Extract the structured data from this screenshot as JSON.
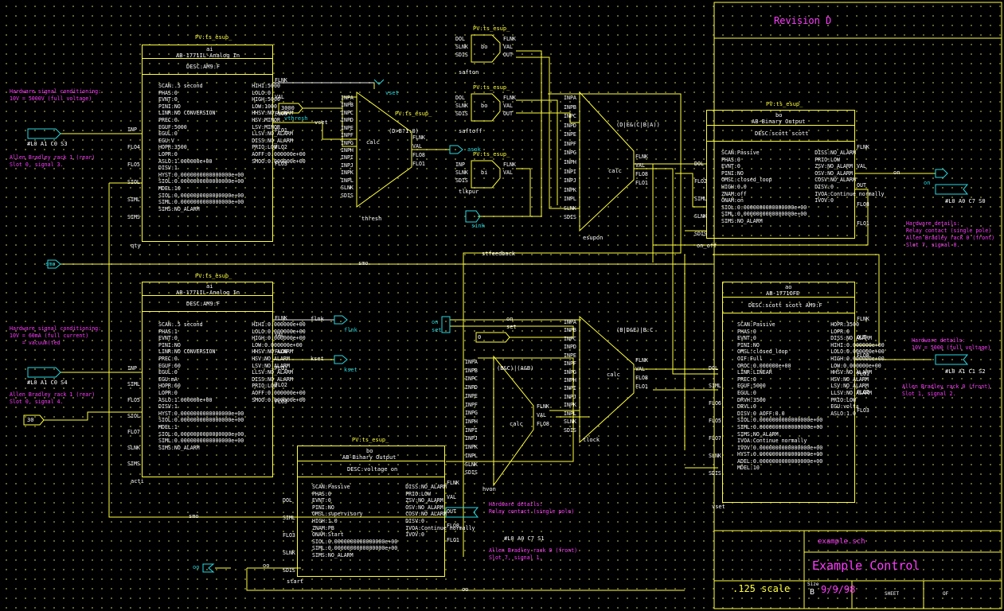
{
  "title_block": {
    "revision": "Revision D",
    "file": "example.sch",
    "drawing_title": "Example Control",
    "scale": ".125 scale",
    "size_label": "Size",
    "size": "B",
    "date": "9/9/98",
    "sheet_label": "SHEET",
    "of_label": "OF"
  },
  "ai_top": {
    "pv": "PV:ts_esup_",
    "type": "ai",
    "model": "AB-1771IL-Analog In",
    "desc": "DESC:AM9:F",
    "name": "qty",
    "fields": [
      [
        "SCAN:.5 second",
        "HIHI:5000"
      ],
      [
        "PHAS:0",
        "LOLO:0"
      ],
      [
        "EVNT:0",
        "HIGH:5000"
      ],
      [
        "PINI:NO",
        "LOW:1000"
      ],
      [
        "LINR:NO CONVERSION",
        "HHSV:NO_ALARM"
      ],
      [
        "PREC:0",
        "HSV:MINOR"
      ],
      [
        "EGUF:5000",
        "LSV:MINOR"
      ],
      [
        "EGUL:0",
        "LLSV:NO_ALARM"
      ],
      [
        "EGU:V",
        "DISS:NO_ALARM"
      ],
      [
        "HOPR:3500",
        "PRIO:LOW"
      ],
      [
        "LOPR:0",
        "AOFF:0.000000e+00"
      ],
      [
        "ASLO:1.000000e+00",
        "SMOO:0.000000e+00"
      ],
      [
        "DISV:1",
        ""
      ],
      [
        "HYST:0.0000000000000000e+00",
        ""
      ],
      [
        "SIOL:0.0000000000000000e+00",
        ""
      ],
      [
        "MDEL:10",
        ""
      ],
      [
        "SIOL:0.0000000000000000e+00",
        ""
      ],
      [
        "SIML:0.0000000000000000e+00",
        ""
      ],
      [
        "SIMS:NO_ALARM",
        ""
      ]
    ],
    "in_pins": [
      "INP",
      "FLO4",
      "FLO5",
      "SIOL",
      "SIML",
      "SIMS"
    ],
    "out_pins": [
      "FLNK",
      "VAL",
      "FLO8",
      "FLO1",
      "FLO2",
      "FLO3"
    ]
  },
  "ai_bottom": {
    "pv": "PV:ts_esup_",
    "type": "ai",
    "model": "AB-1771IL-Analog In",
    "desc": "DESC:AM9:F",
    "name": "acti",
    "fields": [
      [
        "SCAN:.5 second",
        "HIHI:0.000000e+00"
      ],
      [
        "PHAS:1",
        "LOLO:0.000000e+00"
      ],
      [
        "EVNT:0",
        "HIGH:0.000000e+00"
      ],
      [
        "PINI:NO",
        "LOW:0.000000e+00"
      ],
      [
        "LINR:NO CONVERSION",
        "HHSV:NO_ALARM"
      ],
      [
        "PREC:0",
        "HSV:NO_ALARM"
      ],
      [
        "EGUF:60",
        "LSV:NO_ALARM"
      ],
      [
        "EGUL:0",
        "LLSV:NO_ALARM"
      ],
      [
        "EGU:mA",
        "DISS:NO_ALARM"
      ],
      [
        "HOPR:60",
        "PRIO:LOW"
      ],
      [
        "LOPR:0",
        "AOFF:0.000000e+00"
      ],
      [
        "ASLO:1.000000e+00",
        "SMOO:0.000000e+00"
      ],
      [
        "DISV:1",
        ""
      ],
      [
        "HYST:0.0000000000000000e+00",
        ""
      ],
      [
        "SIOL:0.0000000000000000e+00",
        ""
      ],
      [
        "MDEL:1",
        ""
      ],
      [
        "SIOL:0.0000000000000000e+00",
        ""
      ],
      [
        "SIML:0.0000000000000000e+00",
        ""
      ],
      [
        "SIMS:NO_ALARM",
        ""
      ]
    ],
    "in_pins": [
      "INP",
      "SIML",
      "FLO5",
      "SIOL",
      "FLO7",
      "SLNK",
      "SIMS"
    ],
    "out_pins": [
      "FLNK",
      "VAL",
      "FLO8",
      "FLO1",
      "FLO2",
      "FLO3"
    ]
  },
  "bo_bottom": {
    "pv": "PV:ts_esup_",
    "type": "bo",
    "model": "AB-Binary Output",
    "desc": "DESC:voltage on",
    "name": "start",
    "fields": [
      [
        "SCAN:Passive",
        "DISS:NO_ALARM"
      ],
      [
        "PHAS:0",
        "PRIO:LOW"
      ],
      [
        "EVNT:0",
        "ZSV:NO_ALARM"
      ],
      [
        "PINI:NO",
        "OSV:NO_ALARM"
      ],
      [
        "OMSL:supervisory",
        "COSV:NO_ALARM"
      ],
      [
        "HIGH:1.0",
        "DISV:0"
      ],
      [
        "ZNAM:PB",
        "IVOA:Continue normally"
      ],
      [
        "ONAM:Start",
        "IVOV:0"
      ],
      [
        "SIOL:0.0000000000000000e+00",
        ""
      ],
      [
        "SIML:0.0000000000000000e+00",
        ""
      ],
      [
        "SIMS:NO_ALARM",
        ""
      ]
    ],
    "in_pins": [
      "DOL",
      "SIML",
      "FLO3",
      "SLNK",
      "SDIS"
    ],
    "out_pins": [
      "FLNK",
      "VAL",
      "OUT",
      "FLO8",
      "FLO1"
    ]
  },
  "bo_right": {
    "pv": "PV:ts_esup_",
    "type": "bo",
    "model": "AB-Binary Output",
    "desc": "DESC:scott scott",
    "fields": [
      [
        "SCAN:Passive",
        "DISS:NO_ALARM"
      ],
      [
        "PHAS:0",
        "PRIO:LOW"
      ],
      [
        "EVNT:0",
        "ZSV:NO_ALARM"
      ],
      [
        "PINI:NO",
        "OSV:NO_ALARM"
      ],
      [
        "OMSL:closed_loop",
        "COSV:NO_ALARM"
      ],
      [
        "HIGH:0.0",
        "DISV:0"
      ],
      [
        "ZNAM:off",
        "IVOA:Continue normally"
      ],
      [
        "ONAM:on",
        "IVOV:0"
      ],
      [
        "SIOL:0.0000000000000000e+00",
        ""
      ],
      [
        "SIML:0.0000000000000000e+00",
        ""
      ],
      [
        "SIMS:NO_ALARM",
        ""
      ]
    ],
    "in_pins": [
      "DOL",
      "FLO2",
      "SIML",
      "SLNK",
      "SDIS"
    ],
    "out_pins": [
      "FLNK",
      "VAL",
      "OUT",
      "FLO8",
      "FLO1"
    ]
  },
  "ao_right": {
    "pv": "",
    "type": "ao",
    "model": "AB-1771OFE",
    "desc": "DESC:scott scott AM9:F",
    "name": "vset",
    "fields": [
      [
        "SCAN:Passive",
        "HOPR:3500"
      ],
      [
        "PHAS:0",
        "LOPR:0"
      ],
      [
        "EVNT:0",
        "DISS:NO_ALARM"
      ],
      [
        "PINI:NO",
        "HIHI:0.000000e+00"
      ],
      [
        "OMSL:closed_loop",
        "LOLO:0.000000e+00"
      ],
      [
        "OIF:Full",
        "HIGH:0.000000e+00"
      ],
      [
        "OROC:0.000000e+00",
        "LOW:0.000000e+00"
      ],
      [
        "LINR:LINEAR",
        "HHSV:NO_ALARM"
      ],
      [
        "PREC:0",
        "HSV:NO_ALARM"
      ],
      [
        "EGUF:5000",
        "LSV:NO_ALARM"
      ],
      [
        "EGUL:0",
        "LLSV:NO_ALARM"
      ],
      [
        "DRVH:3500",
        "PRIO:LOW"
      ],
      [
        "DRVL:0",
        "EGU:volts"
      ],
      [
        "DISV:0   AOFF:0.0",
        "ASLO:1.0"
      ],
      [
        "SIOL:0.0000000000000000e+00",
        ""
      ],
      [
        "SIML:0.0000000000000000e+00",
        ""
      ],
      [
        "SIMS:NO_ALARM",
        ""
      ],
      [
        "IVOA:Continue normally",
        ""
      ],
      [
        "IVOV:0.0000000000000000e+00",
        ""
      ],
      [
        "HYST:0.0000000000000000e+00",
        ""
      ],
      [
        "ADEL:0.0000000000000000e+00",
        ""
      ],
      [
        "MDEL:10",
        ""
      ]
    ],
    "in_pins": [
      "DOL",
      "SIML",
      "FLO6",
      "FLO5",
      "FLO7",
      "SLNK",
      "SDIS"
    ],
    "out_pins": [
      "FLNK",
      "OUT",
      "FLO8",
      "FLO1",
      "FLO2",
      "FLO3"
    ]
  },
  "small_bo": [
    {
      "pv": "PV:ts_esup_",
      "type": "bo",
      "name": "safton",
      "in": [
        "DOL",
        "SLNK",
        "SDIS"
      ],
      "out": [
        "FLNK",
        "VAL",
        "OUT"
      ]
    },
    {
      "pv": "PV:ts_esup_",
      "type": "bo",
      "name": "saftoff",
      "in": [
        "DOL",
        "SLNK",
        "SDIS"
      ],
      "out": [
        "FLNK",
        "VAL",
        "OUT"
      ]
    },
    {
      "pv": "PV:ts_esup_",
      "type": "bi",
      "name": "tlkpur",
      "in": [
        "INP",
        "SLNK",
        "SDIS"
      ],
      "out": [
        "FLNK",
        "VAL"
      ]
    }
  ],
  "calcs": {
    "thresh": {
      "expr": "(D>B?1:0)",
      "label": "calc",
      "name": "thresh",
      "pv": "PV:ts_esup_",
      "in": [
        "INPA",
        "INPB",
        "INPC",
        "INPD",
        "INPE",
        "INPF",
        "INPG",
        "INPH",
        "INPI",
        "INPJ",
        "INPK",
        "INPL",
        "SLNK",
        "SDIS"
      ],
      "out": [
        "FLNK",
        "VAL",
        "FLO8",
        "FLO1"
      ]
    },
    "esupon": {
      "expr": "(D|E&(C|B|A))",
      "label": "calc",
      "name": "esupon",
      "in": [
        "INPA",
        "INPB",
        "INPC",
        "INPD",
        "INPE",
        "INPF",
        "INPG",
        "INPH",
        "INPI",
        "INPJ",
        "INPK",
        "INPL",
        "SLNK",
        "SDIS"
      ],
      "out": [
        "FLNK",
        "VAL",
        "FLO8",
        "FLO1"
      ]
    },
    "tlock": {
      "expr": "(B|D&E)|B:C",
      "label": "calc",
      "name": "tlock",
      "in": [
        "INPA",
        "INPB",
        "INPC",
        "INPD",
        "INPE",
        "INPF",
        "INPG",
        "INPH",
        "INPI",
        "INPJ",
        "INPK",
        "INPL",
        "SLNK",
        "SDIS"
      ],
      "out": [
        "FLNK",
        "VAL",
        "FLO8",
        "FLO1"
      ]
    },
    "hvon": {
      "expr": "(B&C)|(A&B)",
      "label": "calc",
      "name": "hvon",
      "in": [
        "INPA",
        "INPB",
        "INPC",
        "INPD",
        "INPE",
        "INPF",
        "INPG",
        "INPH",
        "INPI",
        "INPJ",
        "INPK",
        "INPL",
        "SLNK",
        "SDIS"
      ],
      "out": [
        "FLNK",
        "VAL",
        "FLO8"
      ]
    }
  },
  "constants": {
    "vthresh_value": "3000",
    "vthresh": "vthresh",
    "t_value": "0",
    "thirty": "30"
  },
  "signals": {
    "vset": "vset",
    "asok": "asok",
    "sink": "sink",
    "on": "on",
    "on_off": "on_off",
    "stfeedback": "stfeedback",
    "smo": "smo",
    "flnk": "flnk",
    "kset": "kset",
    "on2": "on",
    "set": "set",
    "oo": "oo",
    "smo2": "smo"
  },
  "io_addresses": {
    "ai_top": "#L0 A1 C0 S3",
    "ai_bottom": "#L0 A1 C0 S4",
    "bo_right": "#L0 A0 C7 S0",
    "ao_right": "#L0 A1 C1 S2",
    "bo_bottom": "#L0 A0 C7 S1"
  },
  "notes": {
    "n1": "Hardware signal conditioning:\n10V = 5000V (full voltage)",
    "n2": "Allen Bradley rack 1 (rear)\nSlot 0, signal 3.",
    "n3": "Hardware signal conditioning:\n10V = 60mA (full current)\n    = vacuum(ted",
    "n4": "Allen Bradley rack 1 (rear)\nSlot 0, signal 4.",
    "n5": "Hardware details:\nRelay contact (single pole)\nAllen Bradley rack 0 (front)\nSlot 7, signal 0.",
    "n6": "Hardware details:\n10V = 5000 (full voltage)",
    "n7": "Allen Bradley rack 0 (front)\nSlot 1, signal 2.",
    "n8": "Hardware details:\nRelay contact (single pole)",
    "n9": "Allen Bradley rack 0 (front)\nSlot 7, signal 1."
  }
}
